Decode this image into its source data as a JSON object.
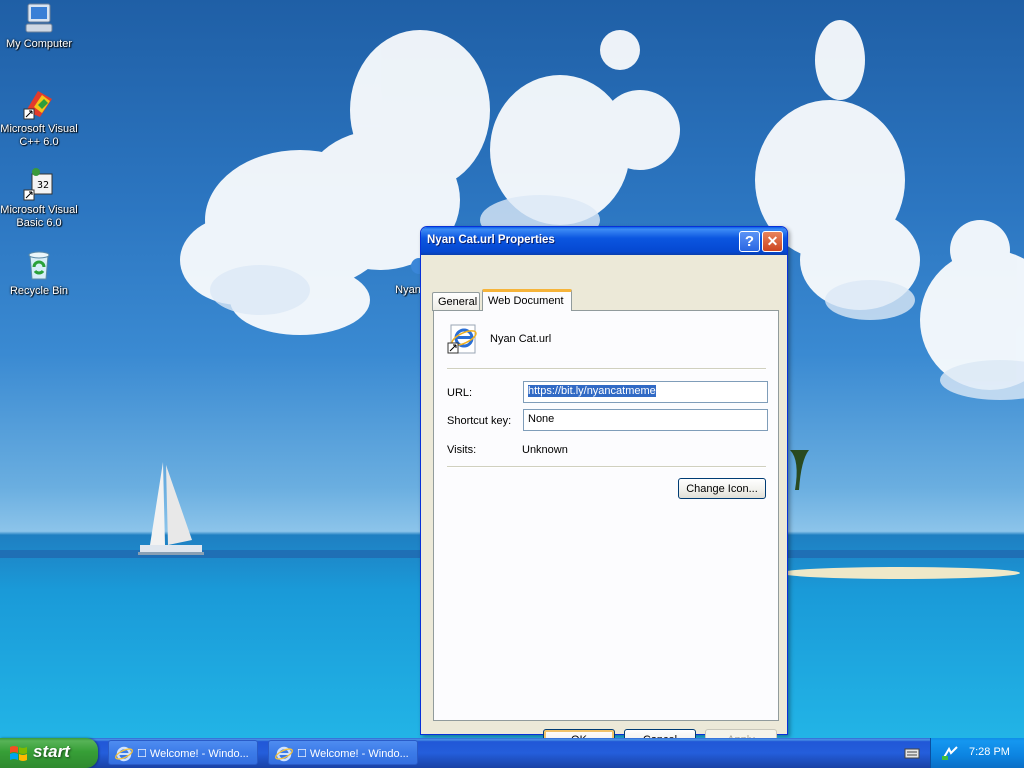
{
  "desktop": {
    "icons": [
      {
        "label": "My Computer"
      },
      {
        "label": "Microsoft Visual\nC++ 6.0"
      },
      {
        "label": "Microsoft Visual\nBasic 6.0"
      },
      {
        "label": "Recycle Bin"
      },
      {
        "label": "Nyan"
      }
    ]
  },
  "dialog": {
    "title": "Nyan Cat.url Properties",
    "help_label": "?",
    "close_label": "✕",
    "tabs": [
      {
        "label": "General"
      },
      {
        "label": "Web Document"
      }
    ],
    "shortcut_name": "Nyan Cat.url",
    "fields": {
      "url_label": "URL:",
      "url_value": "https://bit.ly/nyancatmeme",
      "shortcut_key_label": "Shortcut key:",
      "shortcut_key_value": "None",
      "visits_label": "Visits:",
      "visits_value": "Unknown"
    },
    "buttons": {
      "change_icon": "Change Icon...",
      "ok": "OK",
      "cancel": "Cancel",
      "apply": "Apply"
    }
  },
  "taskbar": {
    "start_label": "start",
    "tasks": [
      {
        "label": "☐ Welcome! - Windo..."
      },
      {
        "label": "☐ Welcome! - Windo..."
      }
    ],
    "clock": "7:28 PM"
  }
}
